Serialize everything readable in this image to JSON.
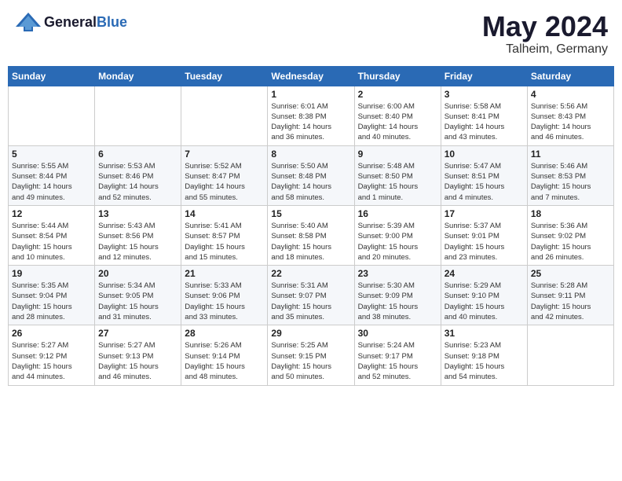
{
  "header": {
    "logo_general": "General",
    "logo_blue": "Blue",
    "month_year": "May 2024",
    "location": "Talheim, Germany"
  },
  "weekdays": [
    "Sunday",
    "Monday",
    "Tuesday",
    "Wednesday",
    "Thursday",
    "Friday",
    "Saturday"
  ],
  "weeks": [
    [
      {
        "day": "",
        "info": ""
      },
      {
        "day": "",
        "info": ""
      },
      {
        "day": "",
        "info": ""
      },
      {
        "day": "1",
        "info": "Sunrise: 6:01 AM\nSunset: 8:38 PM\nDaylight: 14 hours\nand 36 minutes."
      },
      {
        "day": "2",
        "info": "Sunrise: 6:00 AM\nSunset: 8:40 PM\nDaylight: 14 hours\nand 40 minutes."
      },
      {
        "day": "3",
        "info": "Sunrise: 5:58 AM\nSunset: 8:41 PM\nDaylight: 14 hours\nand 43 minutes."
      },
      {
        "day": "4",
        "info": "Sunrise: 5:56 AM\nSunset: 8:43 PM\nDaylight: 14 hours\nand 46 minutes."
      }
    ],
    [
      {
        "day": "5",
        "info": "Sunrise: 5:55 AM\nSunset: 8:44 PM\nDaylight: 14 hours\nand 49 minutes."
      },
      {
        "day": "6",
        "info": "Sunrise: 5:53 AM\nSunset: 8:46 PM\nDaylight: 14 hours\nand 52 minutes."
      },
      {
        "day": "7",
        "info": "Sunrise: 5:52 AM\nSunset: 8:47 PM\nDaylight: 14 hours\nand 55 minutes."
      },
      {
        "day": "8",
        "info": "Sunrise: 5:50 AM\nSunset: 8:48 PM\nDaylight: 14 hours\nand 58 minutes."
      },
      {
        "day": "9",
        "info": "Sunrise: 5:48 AM\nSunset: 8:50 PM\nDaylight: 15 hours\nand 1 minute."
      },
      {
        "day": "10",
        "info": "Sunrise: 5:47 AM\nSunset: 8:51 PM\nDaylight: 15 hours\nand 4 minutes."
      },
      {
        "day": "11",
        "info": "Sunrise: 5:46 AM\nSunset: 8:53 PM\nDaylight: 15 hours\nand 7 minutes."
      }
    ],
    [
      {
        "day": "12",
        "info": "Sunrise: 5:44 AM\nSunset: 8:54 PM\nDaylight: 15 hours\nand 10 minutes."
      },
      {
        "day": "13",
        "info": "Sunrise: 5:43 AM\nSunset: 8:56 PM\nDaylight: 15 hours\nand 12 minutes."
      },
      {
        "day": "14",
        "info": "Sunrise: 5:41 AM\nSunset: 8:57 PM\nDaylight: 15 hours\nand 15 minutes."
      },
      {
        "day": "15",
        "info": "Sunrise: 5:40 AM\nSunset: 8:58 PM\nDaylight: 15 hours\nand 18 minutes."
      },
      {
        "day": "16",
        "info": "Sunrise: 5:39 AM\nSunset: 9:00 PM\nDaylight: 15 hours\nand 20 minutes."
      },
      {
        "day": "17",
        "info": "Sunrise: 5:37 AM\nSunset: 9:01 PM\nDaylight: 15 hours\nand 23 minutes."
      },
      {
        "day": "18",
        "info": "Sunrise: 5:36 AM\nSunset: 9:02 PM\nDaylight: 15 hours\nand 26 minutes."
      }
    ],
    [
      {
        "day": "19",
        "info": "Sunrise: 5:35 AM\nSunset: 9:04 PM\nDaylight: 15 hours\nand 28 minutes."
      },
      {
        "day": "20",
        "info": "Sunrise: 5:34 AM\nSunset: 9:05 PM\nDaylight: 15 hours\nand 31 minutes."
      },
      {
        "day": "21",
        "info": "Sunrise: 5:33 AM\nSunset: 9:06 PM\nDaylight: 15 hours\nand 33 minutes."
      },
      {
        "day": "22",
        "info": "Sunrise: 5:31 AM\nSunset: 9:07 PM\nDaylight: 15 hours\nand 35 minutes."
      },
      {
        "day": "23",
        "info": "Sunrise: 5:30 AM\nSunset: 9:09 PM\nDaylight: 15 hours\nand 38 minutes."
      },
      {
        "day": "24",
        "info": "Sunrise: 5:29 AM\nSunset: 9:10 PM\nDaylight: 15 hours\nand 40 minutes."
      },
      {
        "day": "25",
        "info": "Sunrise: 5:28 AM\nSunset: 9:11 PM\nDaylight: 15 hours\nand 42 minutes."
      }
    ],
    [
      {
        "day": "26",
        "info": "Sunrise: 5:27 AM\nSunset: 9:12 PM\nDaylight: 15 hours\nand 44 minutes."
      },
      {
        "day": "27",
        "info": "Sunrise: 5:27 AM\nSunset: 9:13 PM\nDaylight: 15 hours\nand 46 minutes."
      },
      {
        "day": "28",
        "info": "Sunrise: 5:26 AM\nSunset: 9:14 PM\nDaylight: 15 hours\nand 48 minutes."
      },
      {
        "day": "29",
        "info": "Sunrise: 5:25 AM\nSunset: 9:15 PM\nDaylight: 15 hours\nand 50 minutes."
      },
      {
        "day": "30",
        "info": "Sunrise: 5:24 AM\nSunset: 9:17 PM\nDaylight: 15 hours\nand 52 minutes."
      },
      {
        "day": "31",
        "info": "Sunrise: 5:23 AM\nSunset: 9:18 PM\nDaylight: 15 hours\nand 54 minutes."
      },
      {
        "day": "",
        "info": ""
      }
    ]
  ]
}
